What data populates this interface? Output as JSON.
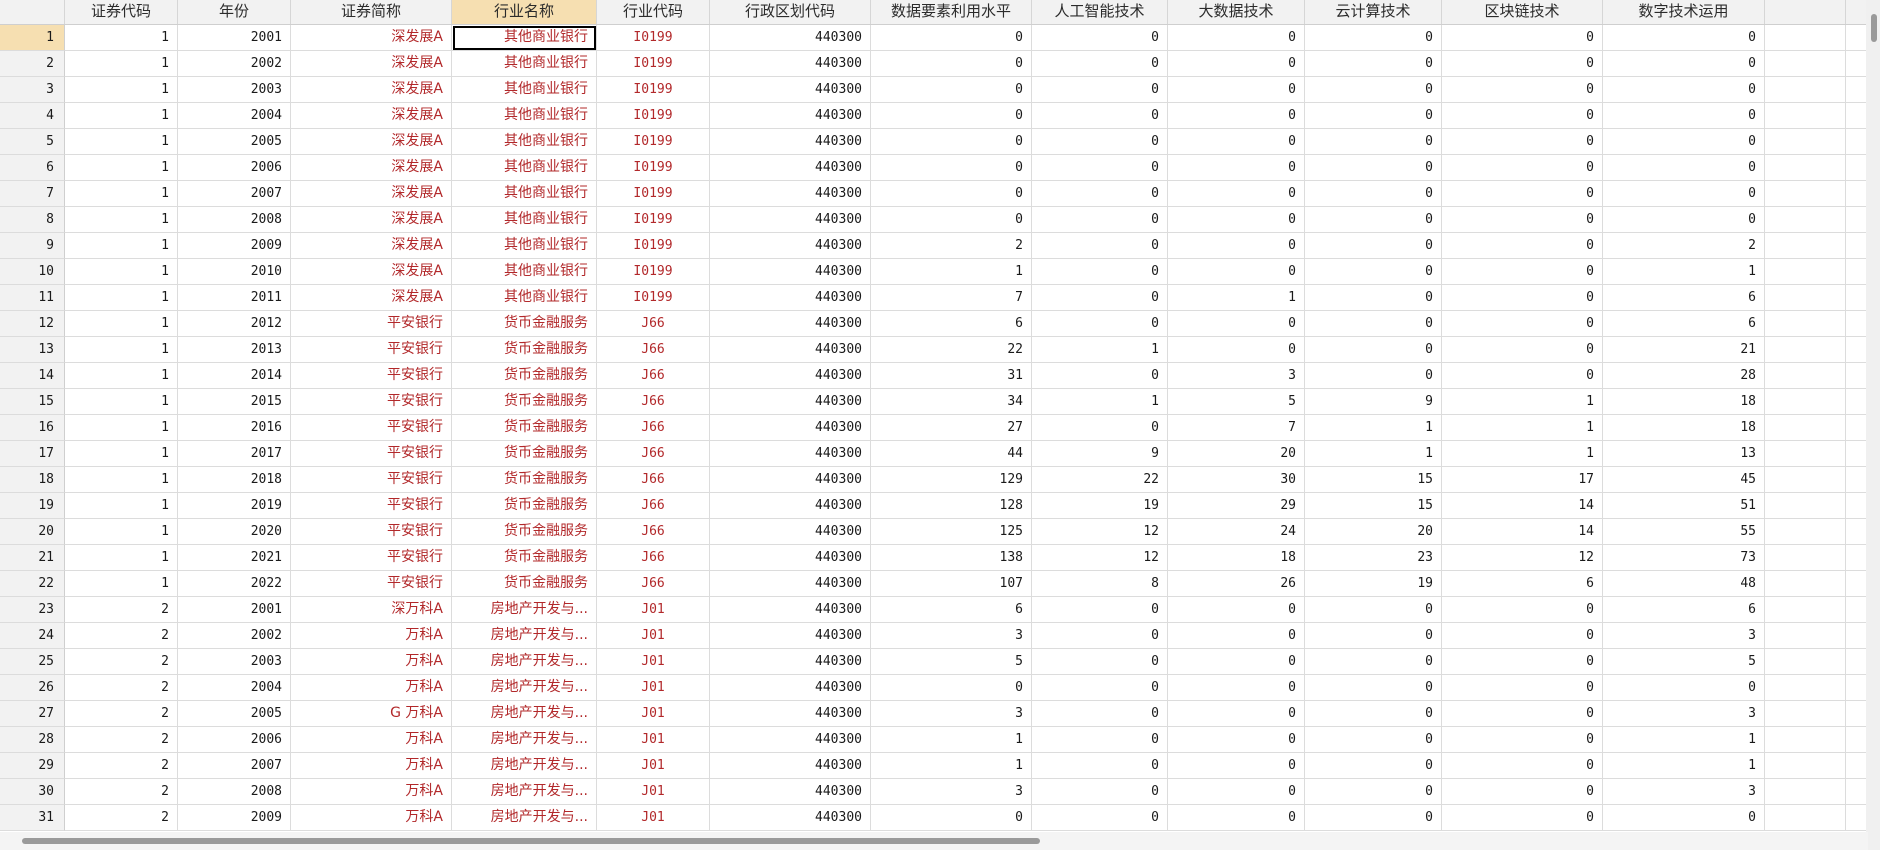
{
  "columns": [
    "证券代码",
    "年份",
    "证券简称",
    "行业名称",
    "行业代码",
    "行政区划代码",
    "数据要素利用水平",
    "人工智能技术",
    "大数据技术",
    "云计算技术",
    "区块链技术",
    "数字技术运用"
  ],
  "active_column": 3,
  "selected_row": 1,
  "rows": [
    {
      "n": "1",
      "c": [
        "1",
        "2001",
        "深发展A",
        "其他商业银行",
        "I0199",
        "440300",
        "0",
        "0",
        "0",
        "0",
        "0",
        "0"
      ]
    },
    {
      "n": "2",
      "c": [
        "1",
        "2002",
        "深发展A",
        "其他商业银行",
        "I0199",
        "440300",
        "0",
        "0",
        "0",
        "0",
        "0",
        "0"
      ]
    },
    {
      "n": "3",
      "c": [
        "1",
        "2003",
        "深发展A",
        "其他商业银行",
        "I0199",
        "440300",
        "0",
        "0",
        "0",
        "0",
        "0",
        "0"
      ]
    },
    {
      "n": "4",
      "c": [
        "1",
        "2004",
        "深发展A",
        "其他商业银行",
        "I0199",
        "440300",
        "0",
        "0",
        "0",
        "0",
        "0",
        "0"
      ]
    },
    {
      "n": "5",
      "c": [
        "1",
        "2005",
        "深发展A",
        "其他商业银行",
        "I0199",
        "440300",
        "0",
        "0",
        "0",
        "0",
        "0",
        "0"
      ]
    },
    {
      "n": "6",
      "c": [
        "1",
        "2006",
        "深发展A",
        "其他商业银行",
        "I0199",
        "440300",
        "0",
        "0",
        "0",
        "0",
        "0",
        "0"
      ]
    },
    {
      "n": "7",
      "c": [
        "1",
        "2007",
        "深发展A",
        "其他商业银行",
        "I0199",
        "440300",
        "0",
        "0",
        "0",
        "0",
        "0",
        "0"
      ]
    },
    {
      "n": "8",
      "c": [
        "1",
        "2008",
        "深发展A",
        "其他商业银行",
        "I0199",
        "440300",
        "0",
        "0",
        "0",
        "0",
        "0",
        "0"
      ]
    },
    {
      "n": "9",
      "c": [
        "1",
        "2009",
        "深发展A",
        "其他商业银行",
        "I0199",
        "440300",
        "2",
        "0",
        "0",
        "0",
        "0",
        "2"
      ]
    },
    {
      "n": "10",
      "c": [
        "1",
        "2010",
        "深发展A",
        "其他商业银行",
        "I0199",
        "440300",
        "1",
        "0",
        "0",
        "0",
        "0",
        "1"
      ]
    },
    {
      "n": "11",
      "c": [
        "1",
        "2011",
        "深发展A",
        "其他商业银行",
        "I0199",
        "440300",
        "7",
        "0",
        "1",
        "0",
        "0",
        "6"
      ]
    },
    {
      "n": "12",
      "c": [
        "1",
        "2012",
        "平安银行",
        "货币金融服务",
        "J66",
        "440300",
        "6",
        "0",
        "0",
        "0",
        "0",
        "6"
      ]
    },
    {
      "n": "13",
      "c": [
        "1",
        "2013",
        "平安银行",
        "货币金融服务",
        "J66",
        "440300",
        "22",
        "1",
        "0",
        "0",
        "0",
        "21"
      ]
    },
    {
      "n": "14",
      "c": [
        "1",
        "2014",
        "平安银行",
        "货币金融服务",
        "J66",
        "440300",
        "31",
        "0",
        "3",
        "0",
        "0",
        "28"
      ]
    },
    {
      "n": "15",
      "c": [
        "1",
        "2015",
        "平安银行",
        "货币金融服务",
        "J66",
        "440300",
        "34",
        "1",
        "5",
        "9",
        "1",
        "18"
      ]
    },
    {
      "n": "16",
      "c": [
        "1",
        "2016",
        "平安银行",
        "货币金融服务",
        "J66",
        "440300",
        "27",
        "0",
        "7",
        "1",
        "1",
        "18"
      ]
    },
    {
      "n": "17",
      "c": [
        "1",
        "2017",
        "平安银行",
        "货币金融服务",
        "J66",
        "440300",
        "44",
        "9",
        "20",
        "1",
        "1",
        "13"
      ]
    },
    {
      "n": "18",
      "c": [
        "1",
        "2018",
        "平安银行",
        "货币金融服务",
        "J66",
        "440300",
        "129",
        "22",
        "30",
        "15",
        "17",
        "45"
      ]
    },
    {
      "n": "19",
      "c": [
        "1",
        "2019",
        "平安银行",
        "货币金融服务",
        "J66",
        "440300",
        "128",
        "19",
        "29",
        "15",
        "14",
        "51"
      ]
    },
    {
      "n": "20",
      "c": [
        "1",
        "2020",
        "平安银行",
        "货币金融服务",
        "J66",
        "440300",
        "125",
        "12",
        "24",
        "20",
        "14",
        "55"
      ]
    },
    {
      "n": "21",
      "c": [
        "1",
        "2021",
        "平安银行",
        "货币金融服务",
        "J66",
        "440300",
        "138",
        "12",
        "18",
        "23",
        "12",
        "73"
      ]
    },
    {
      "n": "22",
      "c": [
        "1",
        "2022",
        "平安银行",
        "货币金融服务",
        "J66",
        "440300",
        "107",
        "8",
        "26",
        "19",
        "6",
        "48"
      ]
    },
    {
      "n": "23",
      "c": [
        "2",
        "2001",
        "深万科A",
        "房地产开发与...",
        "J01",
        "440300",
        "6",
        "0",
        "0",
        "0",
        "0",
        "6"
      ]
    },
    {
      "n": "24",
      "c": [
        "2",
        "2002",
        "万科A",
        "房地产开发与...",
        "J01",
        "440300",
        "3",
        "0",
        "0",
        "0",
        "0",
        "3"
      ]
    },
    {
      "n": "25",
      "c": [
        "2",
        "2003",
        "万科A",
        "房地产开发与...",
        "J01",
        "440300",
        "5",
        "0",
        "0",
        "0",
        "0",
        "5"
      ]
    },
    {
      "n": "26",
      "c": [
        "2",
        "2004",
        "万科A",
        "房地产开发与...",
        "J01",
        "440300",
        "0",
        "0",
        "0",
        "0",
        "0",
        "0"
      ]
    },
    {
      "n": "27",
      "c": [
        "2",
        "2005",
        "G 万科A",
        "房地产开发与...",
        "J01",
        "440300",
        "3",
        "0",
        "0",
        "0",
        "0",
        "3"
      ]
    },
    {
      "n": "28",
      "c": [
        "2",
        "2006",
        "万科A",
        "房地产开发与...",
        "J01",
        "440300",
        "1",
        "0",
        "0",
        "0",
        "0",
        "1"
      ]
    },
    {
      "n": "29",
      "c": [
        "2",
        "2007",
        "万科A",
        "房地产开发与...",
        "J01",
        "440300",
        "1",
        "0",
        "0",
        "0",
        "0",
        "1"
      ]
    },
    {
      "n": "30",
      "c": [
        "2",
        "2008",
        "万科A",
        "房地产开发与...",
        "J01",
        "440300",
        "3",
        "0",
        "0",
        "0",
        "0",
        "3"
      ]
    },
    {
      "n": "31",
      "c": [
        "2",
        "2009",
        "万科A",
        "房地产开发与...",
        "J01",
        "440300",
        "0",
        "0",
        "0",
        "0",
        "0",
        "0"
      ]
    }
  ]
}
